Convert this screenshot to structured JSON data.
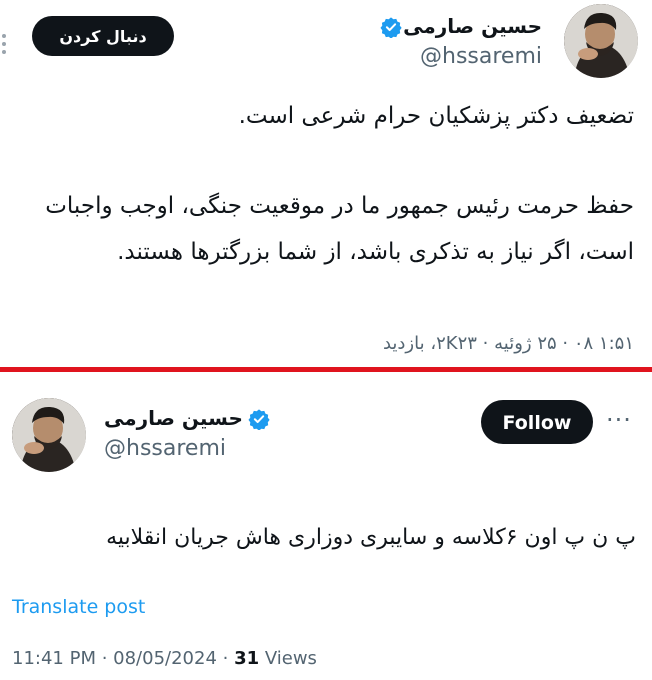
{
  "top_tweet": {
    "author_name": "حسین صارمی",
    "handle": "@hssaremi",
    "follow_label": "دنبال کردن",
    "paragraph1": "تضعیف دکتر پزشکیان حرام شرعی است.",
    "paragraph2": "حفظ حرمت رئیس جمهور ما در موقعیت جنگی، اوجب واجبات است، اگر نیاز به تذکری باشد، از شما بزرگترها هستند.",
    "meta": "۱:۵۱ ۰۸ · ۲۵ ژوئیه · ۲K۲۳، بازدید"
  },
  "bottom_tweet": {
    "author_name": "حسین صارمی",
    "handle": "@hssaremi",
    "follow_label": "Follow",
    "menu_label": "···",
    "text": "پ ن پ اون ۶کلاسه و سایبری دوزاری هاش جریان انقلابیه",
    "translate_label": "Translate post",
    "time": "11:41 PM · 08/05/2024 · ",
    "views_count": "31",
    "views_label": " Views"
  },
  "colors": {
    "divider": "#e0141e",
    "verified": "#1d9bf0",
    "link": "#1d9bf0",
    "muted": "#536471"
  },
  "icons": [
    "verified-badge-icon",
    "more-options-icon"
  ]
}
